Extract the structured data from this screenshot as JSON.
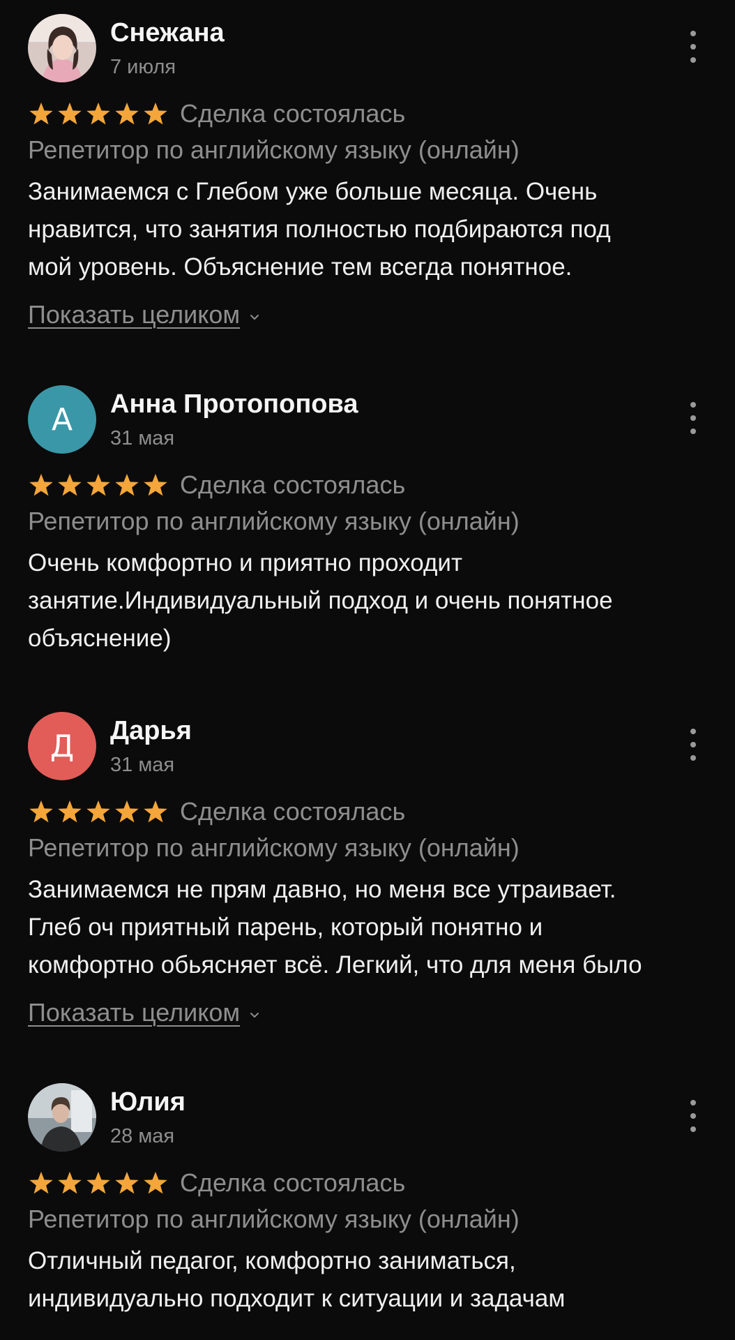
{
  "colors": {
    "background": "#0b0b0b",
    "star": "#f4a63a",
    "secondary_text": "#8e8e8e",
    "avatar_anna": "#3a97a8",
    "avatar_darya": "#e25c58"
  },
  "reviews": [
    {
      "author": "Снежана",
      "date": "7 июля",
      "avatar": {
        "type": "photo",
        "icon": "user-photo"
      },
      "rating": 5,
      "deal_status": "Сделка состоялась",
      "service": "Репетитор по английскому языку (онлайн)",
      "text_lines": [
        "Занимаемся с Глебом уже больше месяца. Очень",
        "нравится, что занятия полностью подбираются под",
        "мой уровень. Объяснение тем всегда понятное."
      ],
      "show_more": "Показать целиком"
    },
    {
      "author": "Анна Протопопова",
      "date": "31 мая",
      "avatar": {
        "type": "letter",
        "letter": "А"
      },
      "rating": 5,
      "deal_status": "Сделка состоялась",
      "service": "Репетитор по английскому языку (онлайн)",
      "text_lines": [
        "Очень комфортно и приятно проходит",
        "занятие.Индивидуальный подход и очень понятное",
        "объяснение)"
      ]
    },
    {
      "author": "Дарья",
      "date": "31 мая",
      "avatar": {
        "type": "letter",
        "letter": "Д"
      },
      "rating": 5,
      "deal_status": "Сделка состоялась",
      "service": "Репетитор по английскому языку (онлайн)",
      "text_lines": [
        "Занимаемся не прям давно, но меня все утраивает.",
        "Глеб оч приятный парень, который понятно и",
        "комфортно обьясняет всё. Легкий, что для меня было"
      ],
      "show_more": "Показать целиком"
    },
    {
      "author": "Юлия",
      "date": "28 мая",
      "avatar": {
        "type": "photo",
        "icon": "user-photo"
      },
      "rating": 5,
      "deal_status": "Сделка состоялась",
      "service": "Репетитор по английскому языку (онлайн)",
      "text_lines": [
        "Отличный педагог, комфортно заниматься,",
        "индивидуально подходит к ситуации и задачам"
      ]
    }
  ]
}
